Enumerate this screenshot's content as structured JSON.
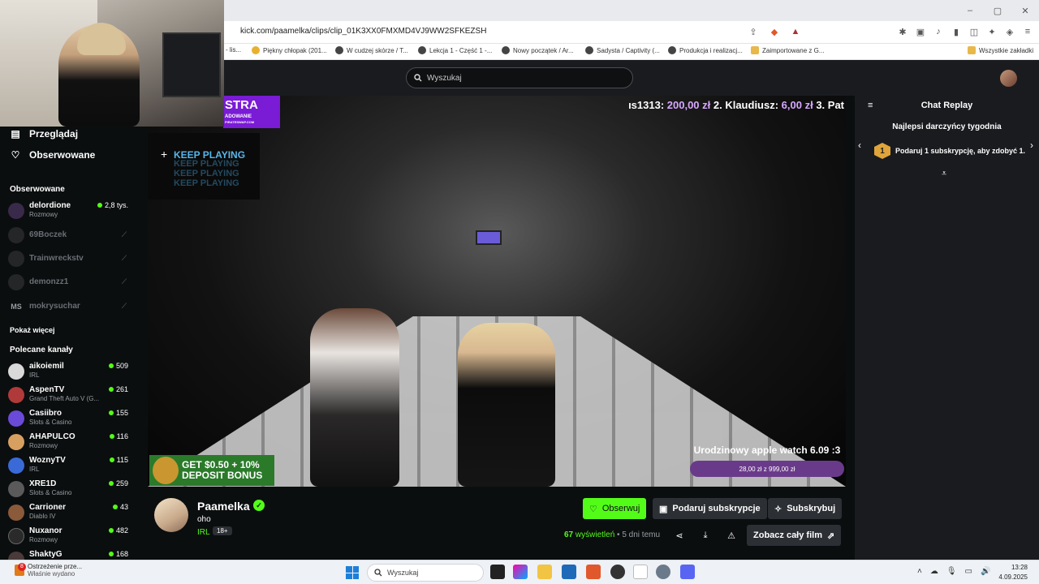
{
  "browser": {
    "url": "kick.com/paamelka/clips/clip_01K3XX0FMXMD4VJ9WW2SFKEZSH",
    "window_controls": [
      "–",
      "▢",
      "✕"
    ],
    "bookmarks": [
      "- lis...",
      "Piękny chłopak (201...",
      "W cudzej skórze / T...",
      "Lekcja 1 - Część 1 -...",
      "Nowy początek / Ar...",
      "Sadysta / Captivity (...",
      "Produkcja i realizacj...",
      "Zaimportowane z G...",
      "Wszystkie zakładki"
    ]
  },
  "site": {
    "search_placeholder": "Wyszukaj"
  },
  "sidebar": {
    "nav": [
      {
        "label": "Przeglądaj",
        "icon": "browse-icon"
      },
      {
        "label": "Obserwowane",
        "icon": "heart-icon"
      }
    ],
    "followed_title": "Obserwowane",
    "followed": [
      {
        "name": "delordione",
        "category": "Rozmowy",
        "viewers": "2,8 tys.",
        "live": true
      },
      {
        "name": "69Boczek",
        "live": false
      },
      {
        "name": "Trainwreckstv",
        "live": false
      },
      {
        "name": "demonzz1",
        "live": false
      },
      {
        "name": "mokrysuchar",
        "initials": "MS",
        "live": false
      }
    ],
    "show_more": "Pokaż więcej",
    "recommended_title": "Polecane kanały",
    "recommended": [
      {
        "name": "aikoiemil",
        "category": "IRL",
        "viewers": "509"
      },
      {
        "name": "AspenTV",
        "category": "Grand Theft Auto V (G...",
        "viewers": "261"
      },
      {
        "name": "Casiibro",
        "category": "Slots & Casino",
        "viewers": "155"
      },
      {
        "name": "AHAPULCO",
        "category": "Rozmowy",
        "viewers": "116"
      },
      {
        "name": "WoznyTV",
        "category": "IRL",
        "viewers": "115"
      },
      {
        "name": "XRE1D",
        "category": "Slots & Casino",
        "viewers": "259"
      },
      {
        "name": "Carrioner",
        "category": "Diablo IV",
        "viewers": "43"
      },
      {
        "name": "Nuxanor",
        "category": "Rozmowy",
        "viewers": "482"
      },
      {
        "name": "ShaktyG",
        "category": "",
        "viewers": "168"
      }
    ]
  },
  "video": {
    "promo_top": "STRA",
    "promo_top_sub": "ADOWANIE",
    "promo_top_small": "PIRATESWAP.COM",
    "keep_playing": "KEEP PLAYING",
    "ticker_prefix": "ıs1313: ",
    "ticker_amt1": "200,00 zł",
    "ticker_mid": " 2. Klaudiusz: ",
    "ticker_amt2": "6,00 zł",
    "ticker_suffix": " 3. Pat",
    "goal_title": "Urodzinowy apple watch 6.09 :3",
    "goal_bar": "28,00 zł z 999,00 zł",
    "deposit_line1": "GET $0.50 + 10%",
    "deposit_line2": "DEPOSIT BONUS"
  },
  "chat": {
    "header": "Chat Replay",
    "top_gifters_title": "Najlepsi darczyńcy tygodnia",
    "gift_badge": "1",
    "gift_text": "Podaruj 1 subskrypcję, aby zdobyć 1."
  },
  "clip": {
    "channel": "Paamelka",
    "title": "oho",
    "category": "IRL",
    "age": "18+",
    "follow_label": "Obserwuj",
    "gift_sub_label": "Podaruj subskrypcje",
    "subscribe_label": "Subskrybuj",
    "views_count": "67",
    "views_label": " wyświetleń",
    "posted": " • 5 dni temu",
    "full_film_label": "Zobacz cały film"
  },
  "taskbar": {
    "notif_title": "Ostrzeżenie prze...",
    "notif_sub": "Właśnie wydano",
    "notif_count": "8",
    "search_placeholder": "Wyszukaj",
    "time": "13:28",
    "date": "4.09.2025"
  },
  "colors": {
    "kick_green": "#53fc18",
    "panel": "#191b1f",
    "background": "#0b0e0f"
  }
}
